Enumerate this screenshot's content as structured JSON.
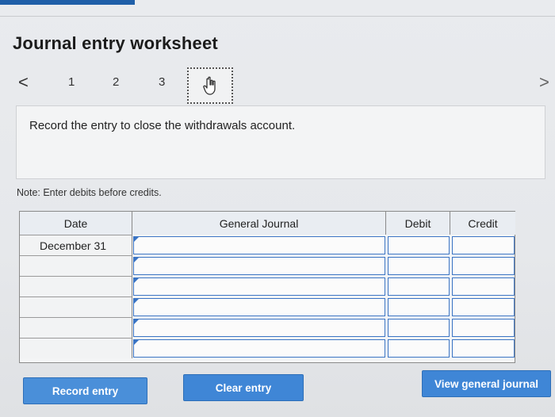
{
  "title": "Journal entry worksheet",
  "nav": {
    "prev_glyph": "<",
    "next_glyph": ">",
    "tabs": [
      "1",
      "2",
      "3"
    ],
    "active_tab_icon": "hand-pointer-icon"
  },
  "prompt": "Record the entry to close the withdrawals account.",
  "note": "Note: Enter debits before credits.",
  "journal": {
    "headers": {
      "date": "Date",
      "general_journal": "General Journal",
      "debit": "Debit",
      "credit": "Credit"
    },
    "rows": [
      {
        "date": "December 31",
        "account": "",
        "debit": "",
        "credit": ""
      },
      {
        "date": "",
        "account": "",
        "debit": "",
        "credit": ""
      },
      {
        "date": "",
        "account": "",
        "debit": "",
        "credit": ""
      },
      {
        "date": "",
        "account": "",
        "debit": "",
        "credit": ""
      },
      {
        "date": "",
        "account": "",
        "debit": "",
        "credit": ""
      },
      {
        "date": "",
        "account": "",
        "debit": "",
        "credit": ""
      }
    ]
  },
  "buttons": {
    "record": "Record entry",
    "clear": "Clear entry",
    "view": "View general journal"
  },
  "colors": {
    "accent": "#3f86d6",
    "input_border": "#3a74c4"
  }
}
